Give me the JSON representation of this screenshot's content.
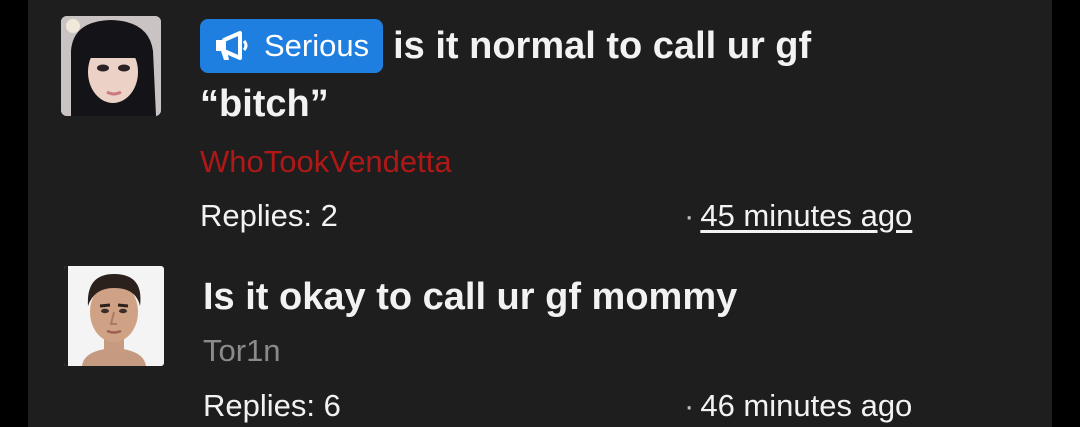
{
  "threads": [
    {
      "badge": "Serious",
      "title": "is it normal to call ur gf “bitch”",
      "author": "WhoTookVendetta",
      "author_color": "#b01818",
      "replies": "Replies: 2",
      "time": "45 minutes ago"
    },
    {
      "title": "Is it okay to call ur gf mommy",
      "author": "Tor1n",
      "author_color": "#8a8a8a",
      "replies": "Replies: 6",
      "time": "46 minutes ago"
    }
  ],
  "icons": {
    "badge_icon": "megaphone-icon"
  },
  "colors": {
    "background": "#1e1e1e",
    "badge": "#1e7fe0",
    "text": "#f2f2f2"
  }
}
